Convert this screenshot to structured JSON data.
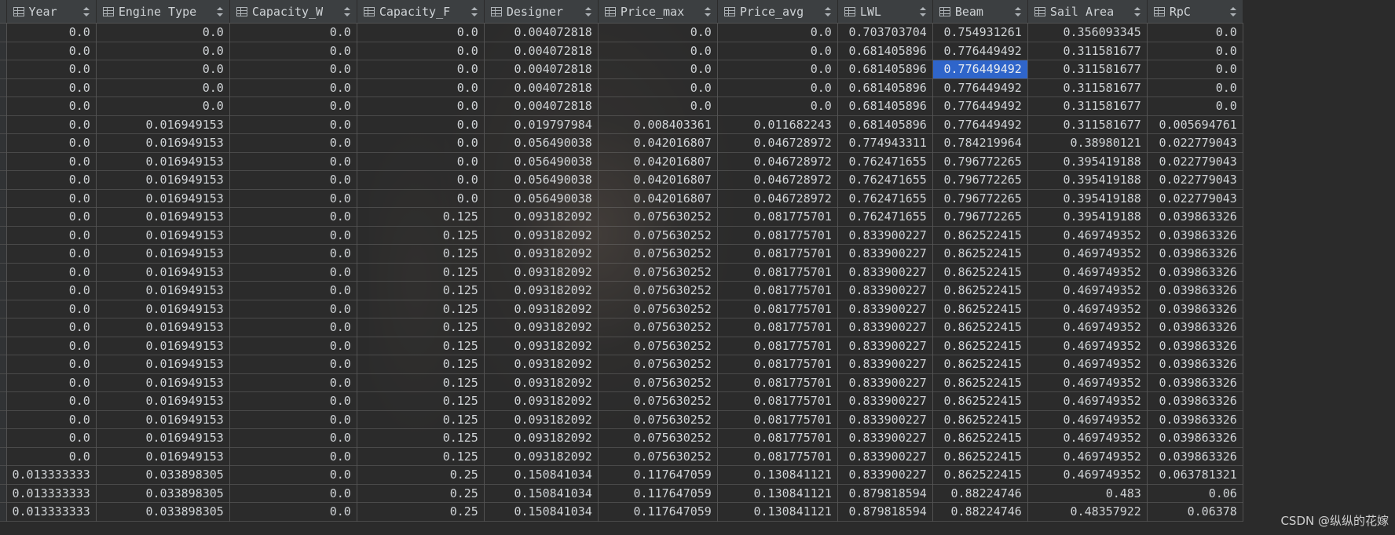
{
  "columns": [
    {
      "label": "Year"
    },
    {
      "label": "Engine Type"
    },
    {
      "label": "Capacity_W"
    },
    {
      "label": "Capacity_F"
    },
    {
      "label": "Designer"
    },
    {
      "label": "Price_max"
    },
    {
      "label": "Price_avg"
    },
    {
      "label": "LWL"
    },
    {
      "label": "Beam"
    },
    {
      "label": "Sail Area"
    },
    {
      "label": "RpC"
    }
  ],
  "rows": [
    [
      "0.0",
      "0.0",
      "0.0",
      "0.0",
      "0.004072818",
      "0.0",
      "0.0",
      "0.703703704",
      "0.754931261",
      "0.356093345",
      "0.0"
    ],
    [
      "0.0",
      "0.0",
      "0.0",
      "0.0",
      "0.004072818",
      "0.0",
      "0.0",
      "0.681405896",
      "0.776449492",
      "0.311581677",
      "0.0"
    ],
    [
      "0.0",
      "0.0",
      "0.0",
      "0.0",
      "0.004072818",
      "0.0",
      "0.0",
      "0.681405896",
      "0.776449492",
      "0.311581677",
      "0.0"
    ],
    [
      "0.0",
      "0.0",
      "0.0",
      "0.0",
      "0.004072818",
      "0.0",
      "0.0",
      "0.681405896",
      "0.776449492",
      "0.311581677",
      "0.0"
    ],
    [
      "0.0",
      "0.0",
      "0.0",
      "0.0",
      "0.004072818",
      "0.0",
      "0.0",
      "0.681405896",
      "0.776449492",
      "0.311581677",
      "0.0"
    ],
    [
      "0.0",
      "0.016949153",
      "0.0",
      "0.0",
      "0.019797984",
      "0.008403361",
      "0.011682243",
      "0.681405896",
      "0.776449492",
      "0.311581677",
      "0.005694761"
    ],
    [
      "0.0",
      "0.016949153",
      "0.0",
      "0.0",
      "0.056490038",
      "0.042016807",
      "0.046728972",
      "0.774943311",
      "0.784219964",
      "0.38980121",
      "0.022779043"
    ],
    [
      "0.0",
      "0.016949153",
      "0.0",
      "0.0",
      "0.056490038",
      "0.042016807",
      "0.046728972",
      "0.762471655",
      "0.796772265",
      "0.395419188",
      "0.022779043"
    ],
    [
      "0.0",
      "0.016949153",
      "0.0",
      "0.0",
      "0.056490038",
      "0.042016807",
      "0.046728972",
      "0.762471655",
      "0.796772265",
      "0.395419188",
      "0.022779043"
    ],
    [
      "0.0",
      "0.016949153",
      "0.0",
      "0.0",
      "0.056490038",
      "0.042016807",
      "0.046728972",
      "0.762471655",
      "0.796772265",
      "0.395419188",
      "0.022779043"
    ],
    [
      "0.0",
      "0.016949153",
      "0.0",
      "0.125",
      "0.093182092",
      "0.075630252",
      "0.081775701",
      "0.762471655",
      "0.796772265",
      "0.395419188",
      "0.039863326"
    ],
    [
      "0.0",
      "0.016949153",
      "0.0",
      "0.125",
      "0.093182092",
      "0.075630252",
      "0.081775701",
      "0.833900227",
      "0.862522415",
      "0.469749352",
      "0.039863326"
    ],
    [
      "0.0",
      "0.016949153",
      "0.0",
      "0.125",
      "0.093182092",
      "0.075630252",
      "0.081775701",
      "0.833900227",
      "0.862522415",
      "0.469749352",
      "0.039863326"
    ],
    [
      "0.0",
      "0.016949153",
      "0.0",
      "0.125",
      "0.093182092",
      "0.075630252",
      "0.081775701",
      "0.833900227",
      "0.862522415",
      "0.469749352",
      "0.039863326"
    ],
    [
      "0.0",
      "0.016949153",
      "0.0",
      "0.125",
      "0.093182092",
      "0.075630252",
      "0.081775701",
      "0.833900227",
      "0.862522415",
      "0.469749352",
      "0.039863326"
    ],
    [
      "0.0",
      "0.016949153",
      "0.0",
      "0.125",
      "0.093182092",
      "0.075630252",
      "0.081775701",
      "0.833900227",
      "0.862522415",
      "0.469749352",
      "0.039863326"
    ],
    [
      "0.0",
      "0.016949153",
      "0.0",
      "0.125",
      "0.093182092",
      "0.075630252",
      "0.081775701",
      "0.833900227",
      "0.862522415",
      "0.469749352",
      "0.039863326"
    ],
    [
      "0.0",
      "0.016949153",
      "0.0",
      "0.125",
      "0.093182092",
      "0.075630252",
      "0.081775701",
      "0.833900227",
      "0.862522415",
      "0.469749352",
      "0.039863326"
    ],
    [
      "0.0",
      "0.016949153",
      "0.0",
      "0.125",
      "0.093182092",
      "0.075630252",
      "0.081775701",
      "0.833900227",
      "0.862522415",
      "0.469749352",
      "0.039863326"
    ],
    [
      "0.0",
      "0.016949153",
      "0.0",
      "0.125",
      "0.093182092",
      "0.075630252",
      "0.081775701",
      "0.833900227",
      "0.862522415",
      "0.469749352",
      "0.039863326"
    ],
    [
      "0.0",
      "0.016949153",
      "0.0",
      "0.125",
      "0.093182092",
      "0.075630252",
      "0.081775701",
      "0.833900227",
      "0.862522415",
      "0.469749352",
      "0.039863326"
    ],
    [
      "0.0",
      "0.016949153",
      "0.0",
      "0.125",
      "0.093182092",
      "0.075630252",
      "0.081775701",
      "0.833900227",
      "0.862522415",
      "0.469749352",
      "0.039863326"
    ],
    [
      "0.0",
      "0.016949153",
      "0.0",
      "0.125",
      "0.093182092",
      "0.075630252",
      "0.081775701",
      "0.833900227",
      "0.862522415",
      "0.469749352",
      "0.039863326"
    ],
    [
      "0.0",
      "0.016949153",
      "0.0",
      "0.125",
      "0.093182092",
      "0.075630252",
      "0.081775701",
      "0.833900227",
      "0.862522415",
      "0.469749352",
      "0.039863326"
    ],
    [
      "0.013333333",
      "0.033898305",
      "0.0",
      "0.25",
      "0.150841034",
      "0.117647059",
      "0.130841121",
      "0.833900227",
      "0.862522415",
      "0.469749352",
      "0.063781321"
    ],
    [
      "0.013333333",
      "0.033898305",
      "0.0",
      "0.25",
      "0.150841034",
      "0.117647059",
      "0.130841121",
      "0.879818594",
      "0.88224746",
      "0.483",
      "0.06"
    ],
    [
      "0.013333333",
      "0.033898305",
      "0.0",
      "0.25",
      "0.150841034",
      "0.117647059",
      "0.130841121",
      "0.879818594",
      "0.88224746",
      "0.48357922",
      "0.06378"
    ]
  ],
  "selected_cell": {
    "row": 2,
    "col": 8
  },
  "watermark": "CSDN @纵纵的花嫁",
  "colors": {
    "background": "#2b2b2b",
    "header": "#3c3f41",
    "selection": "#2f65ca"
  },
  "icons": {
    "column": "table-column-icon",
    "sort": "sort-icon"
  }
}
